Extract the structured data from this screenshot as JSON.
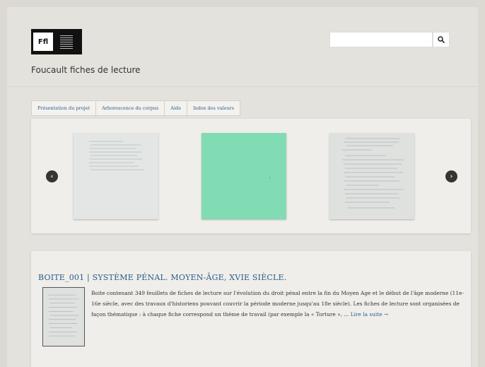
{
  "header": {
    "logo_text": "Ffl",
    "site_title": "Foucault fiches de lecture",
    "search": {
      "placeholder": ""
    }
  },
  "tabs": [
    {
      "label": "Présentation du projet"
    },
    {
      "label": "Arborescence du corpus"
    },
    {
      "label": "Aide"
    },
    {
      "label": "Index des valeurs"
    }
  ],
  "carousel": {
    "prev_symbol": "‹",
    "next_symbol": "›"
  },
  "record": {
    "title": "BOITE_001 | SYSTÈME PÉNAL. MOYEN-ÂGE, XVIE SIÈCLE.",
    "description": "Boite contenant 349 feuillets de fiches de lecture sur l'évolution du droit pénal entre la fin du Moyen Age et le début de l'âge moderne (11e-16e siècle, avec des travaux d'historiens pouvant couvrir la période moderne jusqu'au 18e siècle). Les fiches de lecture sont organisées de façon thématique : à chaque fiche correspond un thème de travail (par exemple la « Torture », ...",
    "read_more": "Lire la suite →"
  }
}
